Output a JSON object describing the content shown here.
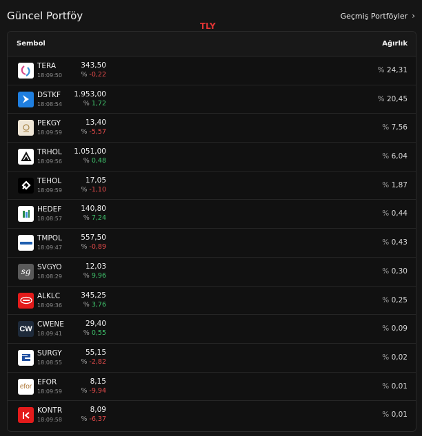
{
  "header": {
    "title": "Güncel Portföy",
    "marker": "TLY",
    "history_label": "Geçmiş Portföyler",
    "history_icon": "chevron-right-icon"
  },
  "table": {
    "col_symbol": "Sembol",
    "col_weight": "Ağırlık",
    "percent_sign": "%",
    "rows": [
      {
        "symbol": "TERA",
        "time": "18:09:50",
        "price": "343,50",
        "change": "-0,22",
        "dir": "neg",
        "weight": "24,31",
        "logo_bg": "#ffffff",
        "logo_fg": "#d84a8a",
        "logo_icon": "tera-logo-icon"
      },
      {
        "symbol": "DSTKF",
        "time": "18:08:54",
        "price": "1.953,00",
        "change": "1,72",
        "dir": "pos",
        "weight": "20,45",
        "logo_bg": "#1f7fe0",
        "logo_fg": "#ffffff",
        "logo_icon": "dstkf-logo-icon"
      },
      {
        "symbol": "PEKGY",
        "time": "18:09:59",
        "price": "13,40",
        "change": "-5,57",
        "dir": "neg",
        "weight": "7,56",
        "logo_bg": "#efe6d6",
        "logo_fg": "#a8864a",
        "logo_icon": "pekgy-logo-icon"
      },
      {
        "symbol": "TRHOL",
        "time": "18:09:56",
        "price": "1.051,00",
        "change": "0,48",
        "dir": "pos",
        "weight": "6,04",
        "logo_bg": "#ffffff",
        "logo_fg": "#111111",
        "logo_icon": "trhol-logo-icon"
      },
      {
        "symbol": "TEHOL",
        "time": "18:09:59",
        "price": "17,05",
        "change": "-1,10",
        "dir": "neg",
        "weight": "1,87",
        "logo_bg": "#000000",
        "logo_fg": "#ffffff",
        "logo_icon": "tehol-logo-icon"
      },
      {
        "symbol": "HEDEF",
        "time": "18:08:57",
        "price": "140,80",
        "change": "7,24",
        "dir": "pos",
        "weight": "0,44",
        "logo_bg": "#ffffff",
        "logo_fg": "#2a8a4a",
        "logo_icon": "hedef-logo-icon"
      },
      {
        "symbol": "TMPOL",
        "time": "18:09:47",
        "price": "557,50",
        "change": "-0,89",
        "dir": "neg",
        "weight": "0,43",
        "logo_bg": "#ffffff",
        "logo_fg": "#1f5fb0",
        "logo_icon": "tmpol-logo-icon"
      },
      {
        "symbol": "SVGYO",
        "time": "18:08:29",
        "price": "12,03",
        "change": "9,96",
        "dir": "pos",
        "weight": "0,30",
        "logo_bg": "#5a5a5a",
        "logo_fg": "#ffffff",
        "logo_icon": "svgyo-logo-icon"
      },
      {
        "symbol": "ALKLC",
        "time": "18:09:36",
        "price": "345,25",
        "change": "3,76",
        "dir": "pos",
        "weight": "0,25",
        "logo_bg": "#e31b1b",
        "logo_fg": "#ffffff",
        "logo_icon": "alklc-logo-icon"
      },
      {
        "symbol": "CWENE",
        "time": "18:09:41",
        "price": "29,40",
        "change": "0,55",
        "dir": "pos",
        "weight": "0,09",
        "logo_bg": "#1e2a3a",
        "logo_fg": "#ffffff",
        "logo_icon": "cwene-logo-icon"
      },
      {
        "symbol": "SURGY",
        "time": "18:08:55",
        "price": "55,15",
        "change": "-2,82",
        "dir": "neg",
        "weight": "0,02",
        "logo_bg": "#ffffff",
        "logo_fg": "#1f4fa0",
        "logo_icon": "surgy-logo-icon"
      },
      {
        "symbol": "EFOR",
        "time": "18:09:59",
        "price": "8,15",
        "change": "-9,94",
        "dir": "neg",
        "weight": "0,01",
        "logo_bg": "#ffffff",
        "logo_fg": "#b07a3a",
        "logo_icon": "efor-logo-icon"
      },
      {
        "symbol": "KONTR",
        "time": "18:09:58",
        "price": "8,09",
        "change": "-6,37",
        "dir": "neg",
        "weight": "0,01",
        "logo_bg": "#e31b1b",
        "logo_fg": "#ffffff",
        "logo_icon": "kontr-logo-icon"
      }
    ]
  },
  "colors": {
    "positive": "#3fc46c",
    "negative": "#e84c4c",
    "marker": "#e03434"
  }
}
